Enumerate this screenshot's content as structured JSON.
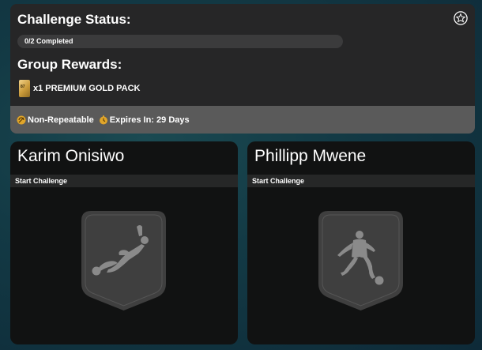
{
  "status": {
    "title": "Challenge Status:",
    "progress_text": "0/2 Completed",
    "progress_fraction": 0,
    "star_icon": "star-icon"
  },
  "rewards": {
    "title": "Group Rewards:",
    "items": [
      {
        "icon": "gold-pack-icon",
        "pack_mark": "87",
        "label": "x1 PREMIUM GOLD PACK"
      }
    ]
  },
  "footer": {
    "non_repeatable": "Non-Repeatable",
    "expires": "Expires In: 29 Days"
  },
  "challenges": [
    {
      "name": "Karim Onisiwo",
      "action": "Start Challenge",
      "icon": "player-silhouette-diving-icon"
    },
    {
      "name": "Phillipp Mwene",
      "action": "Start Challenge",
      "icon": "player-silhouette-dribbling-icon"
    }
  ],
  "colors": {
    "panel": "#262627",
    "footer": "#5a5a5a",
    "card": "#111212",
    "badge": "#3f3f3f",
    "silhouette": "#8a8a8a",
    "accent_gold": "#e0a52a"
  }
}
